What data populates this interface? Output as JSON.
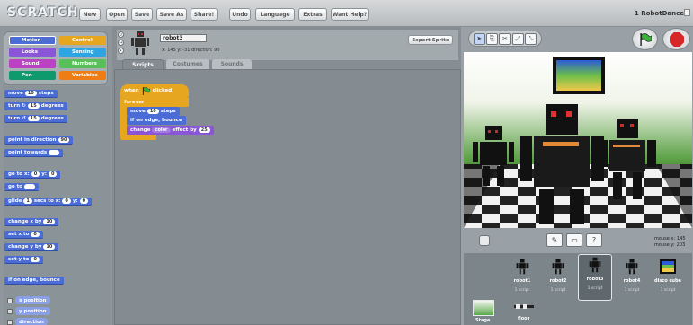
{
  "app": {
    "logo": "SCRATCH",
    "project_title": "1 RobotDance"
  },
  "menu": [
    "New",
    "Open",
    "Save",
    "Save As",
    "Share!",
    "Undo",
    "Language",
    "Extras",
    "Want Help?"
  ],
  "categories": [
    {
      "label": "Motion",
      "color": "#4a6cd4"
    },
    {
      "label": "Control",
      "color": "#e6a620"
    },
    {
      "label": "Looks",
      "color": "#8a55d7"
    },
    {
      "label": "Sensing",
      "color": "#2ca5e2"
    },
    {
      "label": "Sound",
      "color": "#bb42c3"
    },
    {
      "label": "Numbers",
      "color": "#59c059"
    },
    {
      "label": "Pen",
      "color": "#0e9a6c"
    },
    {
      "label": "Variables",
      "color": "#ee7d16"
    }
  ],
  "palette": {
    "move": {
      "a": "move",
      "v": "10",
      "b": "steps"
    },
    "turn_right": {
      "a": "turn",
      "v": "15",
      "b": "degrees"
    },
    "turn_left": {
      "a": "turn",
      "v": "15",
      "b": "degrees"
    },
    "point_dir": {
      "a": "point in direction",
      "v": "90"
    },
    "point_towards": {
      "a": "point towards"
    },
    "goto_xy": {
      "a": "go to x:",
      "vx": "0",
      "b": "y:",
      "vy": "0"
    },
    "goto": {
      "a": "go to"
    },
    "glide": {
      "a": "glide",
      "v1": "1",
      "b": "secs to x:",
      "v2": "0",
      "c": "y:",
      "v3": "0"
    },
    "change_x": {
      "a": "change x by",
      "v": "10"
    },
    "set_x": {
      "a": "set x to",
      "v": "0"
    },
    "change_y": {
      "a": "change y by",
      "v": "10"
    },
    "set_y": {
      "a": "set y to",
      "v": "0"
    },
    "bounce": "if on edge, bounce",
    "reporters": [
      "x position",
      "y position",
      "direction"
    ]
  },
  "sprite": {
    "name": "robot3",
    "coords": "x: 145  y: -31  direction: 90",
    "export_label": "Export Sprite",
    "tabs": [
      "Scripts",
      "Costumes",
      "Sounds"
    ],
    "active_tab": "Scripts"
  },
  "script": {
    "hat": "when",
    "hat_after": "clicked",
    "loop": "forever",
    "move_a": "move",
    "move_v": "10",
    "move_b": "steps",
    "bounce": "if on edge, bounce",
    "change_a": "change",
    "change_effect": "color",
    "change_b": "effect by",
    "change_v": "25"
  },
  "stage": {
    "mouse_x_label": "mouse x:",
    "mouse_x": "145",
    "mouse_y_label": "mouse y:",
    "mouse_y": "203"
  },
  "sprites": [
    {
      "name": "robot1",
      "scripts": "1 script"
    },
    {
      "name": "robot2",
      "scripts": "1 script"
    },
    {
      "name": "robot3",
      "scripts": "1 script",
      "selected": true
    },
    {
      "name": "robot4",
      "scripts": "1 script"
    },
    {
      "name": "disco cube",
      "scripts": "1 script"
    }
  ],
  "stage_item": {
    "name": "Stage"
  },
  "floor_item": {
    "name": "floor"
  },
  "colors": {
    "motion": "#4a6cd4",
    "control": "#e6a620",
    "looks": "#8a55d7",
    "green_flag": "#3cae3c",
    "stop": "#d62828"
  }
}
